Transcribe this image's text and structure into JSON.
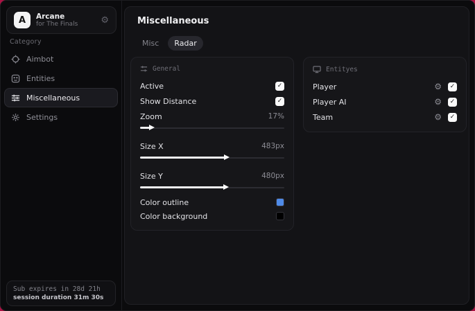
{
  "app": {
    "logo_letter": "A",
    "name": "Arcane",
    "subtitle": "for The Finals"
  },
  "icons": {
    "gear_glyph": "⚙",
    "check_glyph": "✓"
  },
  "sidebar": {
    "category_label": "Category",
    "items": [
      {
        "label": "Aimbot",
        "icon": "crosshair-icon",
        "selected": false
      },
      {
        "label": "Entities",
        "icon": "entities-icon",
        "selected": false
      },
      {
        "label": "Miscellaneous",
        "icon": "sliders-icon",
        "selected": true
      },
      {
        "label": "Settings",
        "icon": "gear-icon",
        "selected": false
      }
    ],
    "footer": {
      "sub_expires": "Sub expires in 28d 21h",
      "session_duration": "session duration 31m 30s"
    }
  },
  "main": {
    "title": "Miscellaneous",
    "tabs": [
      {
        "label": "Misc",
        "active": false
      },
      {
        "label": "Radar",
        "active": true
      }
    ],
    "general": {
      "header": "General",
      "toggles": [
        {
          "label": "Active",
          "checked": true
        },
        {
          "label": "Show Distance",
          "checked": true
        }
      ],
      "sliders": [
        {
          "label": "Zoom",
          "value": "17%",
          "fill": "8.5%"
        },
        {
          "label": "Size X",
          "value": "483px",
          "fill": "60.4%"
        },
        {
          "label": "Size Y",
          "value": "480px",
          "fill": "60%"
        }
      ],
      "colors": [
        {
          "label": "Color outline",
          "hex": "#4f8be8"
        },
        {
          "label": "Color background",
          "hex": "#000000"
        }
      ]
    },
    "entities": {
      "header": "Entityes",
      "rows": [
        {
          "label": "Player",
          "checked": true
        },
        {
          "label": "Player AI",
          "checked": true
        },
        {
          "label": "Team",
          "checked": true
        }
      ]
    }
  },
  "colors": {
    "accent_backdrop": "#ac1243",
    "accent_blue": "#4f8be8"
  }
}
